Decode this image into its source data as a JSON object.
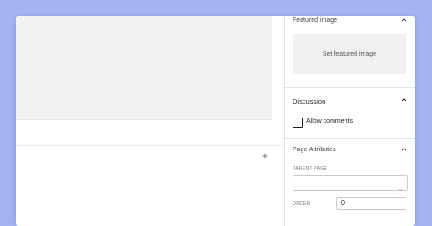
{
  "sidebar": {
    "featured_image": {
      "title": "Featured image",
      "button_label": "Set featured image"
    },
    "discussion": {
      "title": "Discussion",
      "allow_comments_label": "Allow comments",
      "allow_comments_checked": false
    },
    "page_attributes": {
      "title": "Page Attributes",
      "parent_page_label": "PARENT PAGE",
      "parent_page_value": "",
      "order_label": "ORDER",
      "order_value": "0"
    }
  },
  "editor": {
    "add_block_icon": "plus-icon"
  },
  "colors": {
    "background": "#a7b2f2",
    "panel": "#ffffff",
    "placeholder": "#f0f0f0"
  }
}
